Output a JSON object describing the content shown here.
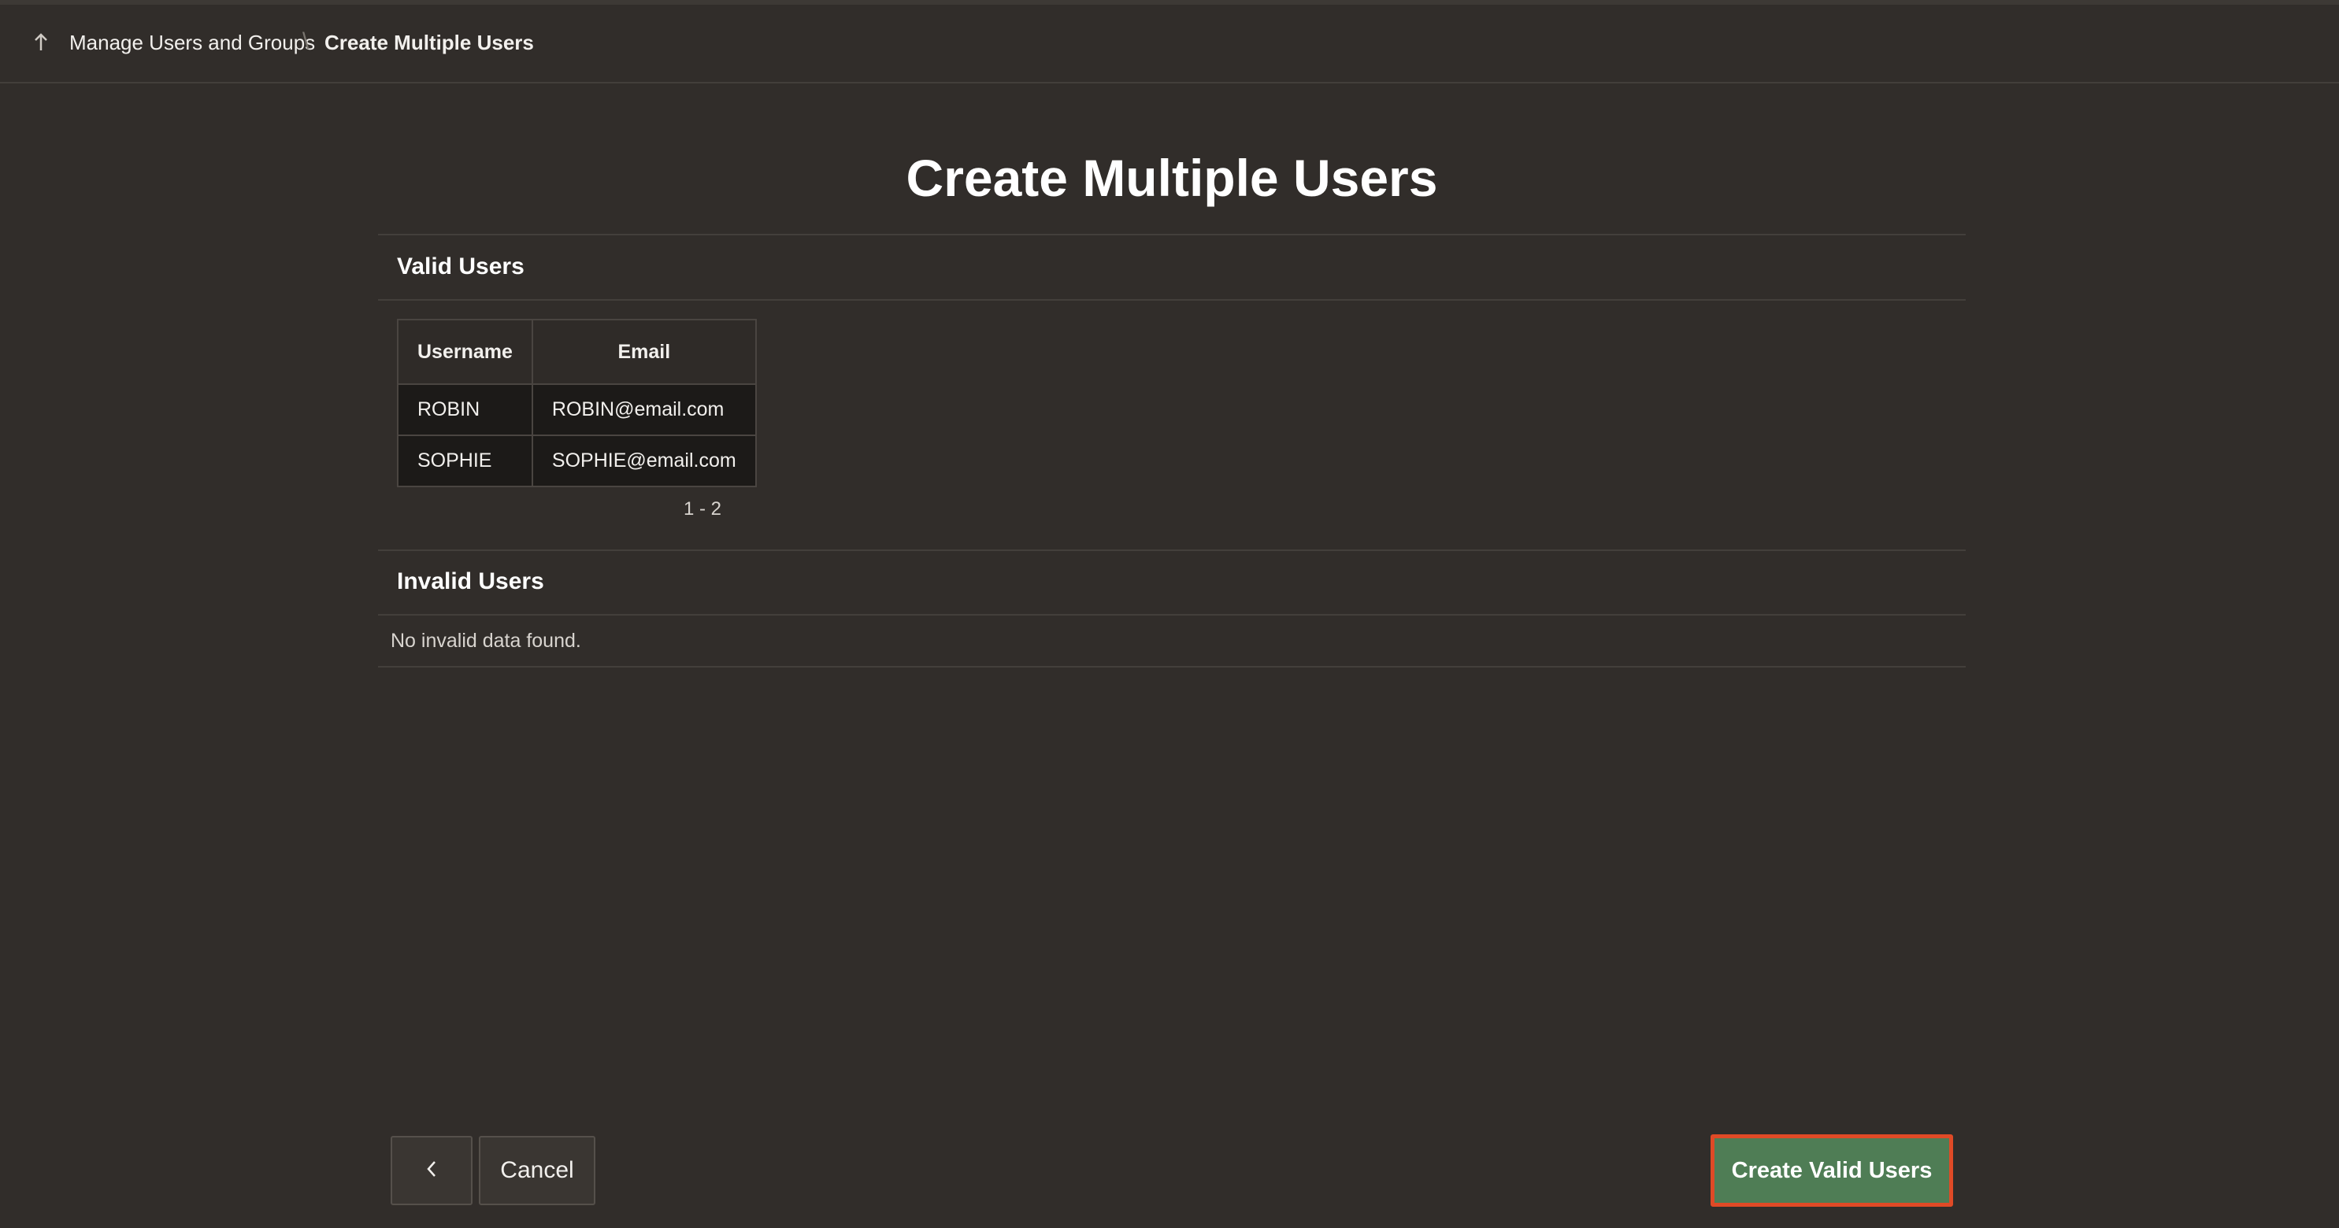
{
  "breadcrumb": {
    "parent_label": "Manage Users and Groups",
    "separator": "\\",
    "current_label": "Create Multiple Users"
  },
  "page": {
    "title": "Create Multiple Users"
  },
  "valid_users": {
    "title": "Valid Users",
    "columns": [
      "Username",
      "Email"
    ],
    "rows": [
      [
        "ROBIN",
        "ROBIN@email.com"
      ],
      [
        "SOPHIE",
        "SOPHIE@email.com"
      ]
    ],
    "pagination": "1 - 2"
  },
  "invalid_users": {
    "title": "Invalid Users",
    "message": "No invalid data found."
  },
  "footer": {
    "back_icon": "chevron-left-icon",
    "cancel_label": "Cancel",
    "create_label": "Create Valid Users"
  },
  "colors": {
    "background": "#312d2a",
    "primary_button": "#4f7d55",
    "highlight_outline": "#e04a26"
  }
}
